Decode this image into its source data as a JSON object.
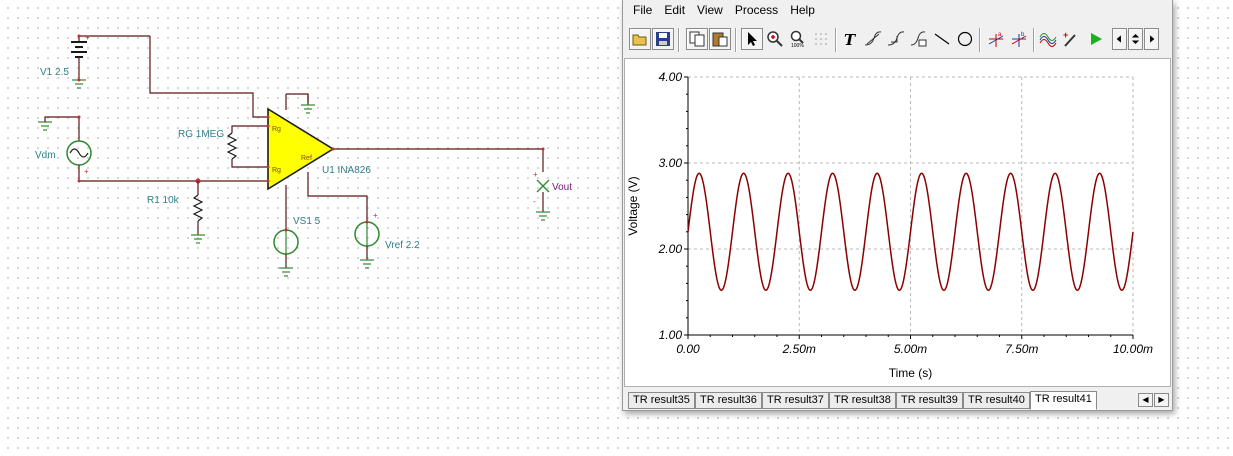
{
  "schematic": {
    "components": {
      "v1": "V1 2.5",
      "vdm": "Vdm",
      "rg": "RG 1MEG",
      "r1": "R1 10k",
      "u1": "U1 INA826",
      "vs1": "VS1 5",
      "vref": "Vref 2.2",
      "vout": "Vout"
    },
    "pins": {
      "rg_top": "Rg",
      "rg_bottom": "Rg",
      "ref": "Ref"
    },
    "colors": {
      "wire": "#5c1616",
      "ground": "#2e8a2e",
      "opamp_fill": "#ffff00",
      "label": "#2f7f88"
    }
  },
  "analysis_window": {
    "menu": [
      "File",
      "Edit",
      "View",
      "Process",
      "Help"
    ],
    "toolbar": [
      "open-icon",
      "save-icon",
      "copy-icon",
      "paste-icon",
      "select-arrow-icon",
      "zoom-in-icon",
      "zoom-100-icon",
      "grid-icon",
      "text-icon",
      "tangent-icon",
      "slope-icon",
      "equation-icon",
      "line-icon",
      "circle-icon",
      "cursor-a-icon",
      "cursor-b-icon",
      "waveform-icon",
      "probe-icon",
      "run-icon",
      "tab-left-icon",
      "updown-icon",
      "tab-right-icon"
    ],
    "tabs": [
      "TR result35",
      "TR result36",
      "TR result37",
      "TR result38",
      "TR result39",
      "TR result40",
      "TR result41"
    ],
    "active_tab": "TR result41"
  },
  "chart_data": {
    "type": "line",
    "title": "",
    "xlabel": "Time (s)",
    "ylabel": "Voltage (V)",
    "xlim": [
      0,
      0.01
    ],
    "ylim": [
      1.0,
      4.0
    ],
    "x_ticks": [
      "0.00",
      "2.50m",
      "5.00m",
      "7.50m",
      "10.00m"
    ],
    "y_ticks": [
      "1.00",
      "2.00",
      "3.00",
      "4.00"
    ],
    "grid": true,
    "series": [
      {
        "color": "#8b0000",
        "waveform": "sine",
        "offset": 2.2,
        "amplitude": 0.68,
        "frequency_hz": 1000,
        "phase_deg": 0
      }
    ]
  }
}
